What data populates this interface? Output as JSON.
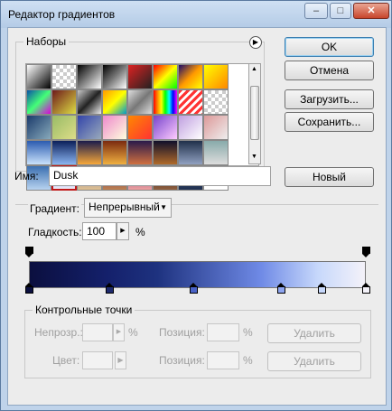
{
  "window": {
    "title": "Редактор градиентов"
  },
  "presets": {
    "label": "Наборы",
    "swatches": [
      {
        "bg": "linear-gradient(135deg,#ffffff,#000)"
      },
      {
        "bg": "repeating-conic-gradient(#ccc 0 25%,#fff 0 50%) 0 0/8px 8px"
      },
      {
        "bg": "linear-gradient(135deg,#000,#fff)"
      },
      {
        "bg": "linear-gradient(135deg,#000,#777,#fff)"
      },
      {
        "bg": "linear-gradient(135deg,#d22,#222)"
      },
      {
        "bg": "linear-gradient(135deg,#f00,#ff0,#0f0)"
      },
      {
        "bg": "linear-gradient(135deg,#1a0a6b,#f90,#ff0)"
      },
      {
        "bg": "linear-gradient(135deg,#ff0,#f80)"
      },
      {
        "bg": "linear-gradient(135deg,#0a52a6,#4f7,#d0d)"
      },
      {
        "bg": "linear-gradient(135deg,#6e1a1a,#dd4)"
      },
      {
        "bg": "linear-gradient(135deg,#c8c8c8,#222,#eee)"
      },
      {
        "bg": "linear-gradient(135deg,#f90,#ff0,#09c)"
      },
      {
        "bg": "linear-gradient(135deg,#ddd,#777,#ddd)"
      },
      {
        "bg": "linear-gradient(90deg,#f00,#f80,#ff0,#0f0,#0ff,#00f,#f0f)"
      },
      {
        "bg": "repeating-linear-gradient(135deg,#f33 0 3px,#fff 3px 6px)"
      },
      {
        "bg": "repeating-conic-gradient(#ccc 0 25%,#fff 0 50%) 0 0/8px 8px"
      },
      {
        "bg": "linear-gradient(135deg,#1a3a6b,#8ab)"
      },
      {
        "bg": "linear-gradient(135deg,#9b6,#dd8)"
      },
      {
        "bg": "linear-gradient(135deg,#34a,#9ab)"
      },
      {
        "bg": "linear-gradient(135deg,#e8c,#ffd)"
      },
      {
        "bg": "linear-gradient(135deg,#f80,#f33)"
      },
      {
        "bg": "linear-gradient(135deg,#74c,#fcf)"
      },
      {
        "bg": "linear-gradient(135deg,#c0a0e0,#fff)"
      },
      {
        "bg": "linear-gradient(135deg,#d99,#eee)"
      },
      {
        "bg": "linear-gradient(180deg,#2b5bb0,#c9e2fb)"
      },
      {
        "bg": "linear-gradient(180deg,#0b1f5a,#8ab4f0)"
      },
      {
        "bg": "linear-gradient(180deg,#1b1b4b,#f7a83a)"
      },
      {
        "bg": "linear-gradient(180deg,#7a2a10,#f0b040)"
      },
      {
        "bg": "linear-gradient(180deg,#2a1a4a,#d07040)"
      },
      {
        "bg": "linear-gradient(180deg,#10102a,#b06a2a)"
      },
      {
        "bg": "linear-gradient(180deg,#20304a,#90a0c0)"
      },
      {
        "bg": "linear-gradient(180deg,#8aa,#ddd)"
      },
      {
        "bg": "linear-gradient(180deg,#3a6fb0,#b8d3f0)"
      },
      {
        "bg": "linear-gradient(180deg,#0b0f3f,#6f8ae6,#f4f2f9)"
      },
      {
        "bg": "linear-gradient(180deg,#6a7ab0,#e0c090)"
      },
      {
        "bg": "linear-gradient(180deg,#3a2a6a,#c08050)"
      },
      {
        "bg": "linear-gradient(180deg,#50307a,#f0a0a0)"
      },
      {
        "bg": "linear-gradient(180deg,#201010,#906040)"
      },
      {
        "bg": "linear-gradient(180deg,#4a5a80,#203050)"
      },
      {
        "bg": "#fff"
      }
    ],
    "selected_index": 33
  },
  "buttons": {
    "ok": "OK",
    "cancel": "Отмена",
    "load": "Загрузить...",
    "save": "Сохранить...",
    "new": "Новый"
  },
  "name_field": {
    "label": "Имя:",
    "value": "Dusk"
  },
  "gradient": {
    "type_label": "Градиент:",
    "type_value": "Непрерывный",
    "smoothness_label": "Гладкость:",
    "smoothness_value": "100",
    "smoothness_unit": "%",
    "color_stops_pct": [
      0,
      24,
      49,
      75,
      87,
      100
    ],
    "color_stop_colors": [
      "#0b0f3f",
      "#1e2a6e",
      "#4a63c7",
      "#8ea5f0",
      "#c7d8fb",
      "#f4f2f9"
    ],
    "opacity_stops_pct": [
      0,
      100
    ]
  },
  "stops_group": {
    "label": "Контрольные точки",
    "opacity_label": "Непрозр.:",
    "opacity_unit": "%",
    "opacity_location_label": "Позиция:",
    "opacity_location_unit": "%",
    "opacity_delete": "Удалить",
    "color_label": "Цвет:",
    "color_location_label": "Позиция:",
    "color_location_unit": "%",
    "color_delete": "Удалить"
  }
}
